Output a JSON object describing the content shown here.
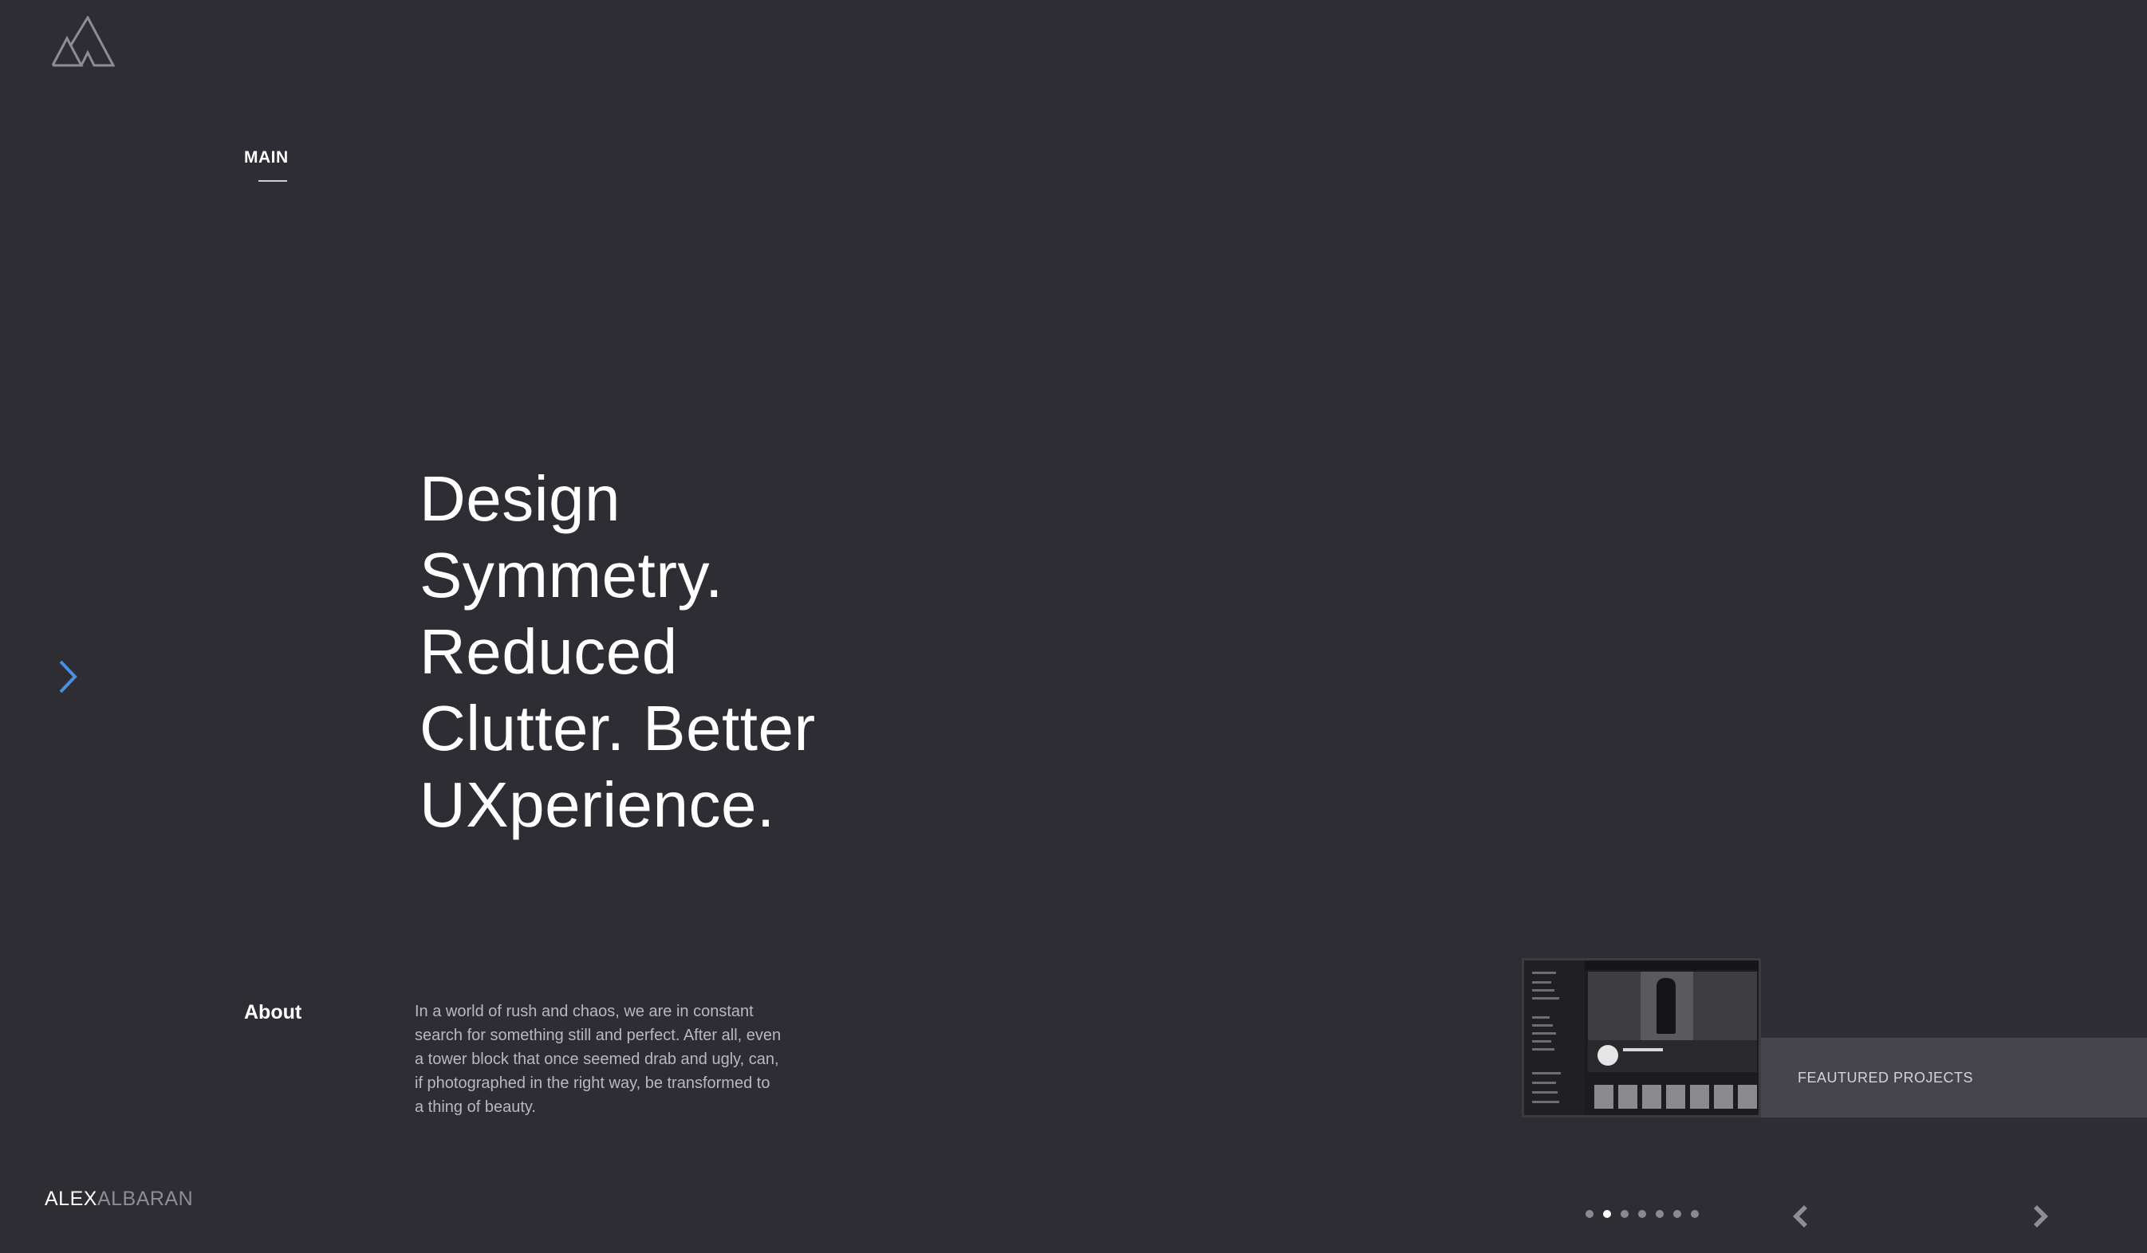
{
  "brand": {
    "first": "ALEX",
    "last": "ALBARAN"
  },
  "nav": {
    "main_label": "MAIN"
  },
  "hero": {
    "lines": [
      "Design",
      "Symmetry.",
      "Reduced",
      "Clutter. Better",
      "UXperience."
    ]
  },
  "about": {
    "heading": "About",
    "text": "In a world of rush and chaos, we are in constant search for something still and perfect. After all, even a tower block that once seemed drab and ugly, can, if photographed in the right way, be transformed to a thing of beauty."
  },
  "featured": {
    "label": "FEAUTURED PROJECTS"
  },
  "pagination": {
    "total": 7,
    "active_index": 1
  },
  "icons": {
    "logo": "mountain-logo-icon",
    "side_next": "chevron-right-icon",
    "prev": "chevron-left-icon",
    "next": "chevron-right-icon"
  },
  "colors": {
    "background": "#2e2d33",
    "accent": "#4a90e2",
    "band": "#46454d",
    "muted_text": "#b9b8be"
  }
}
